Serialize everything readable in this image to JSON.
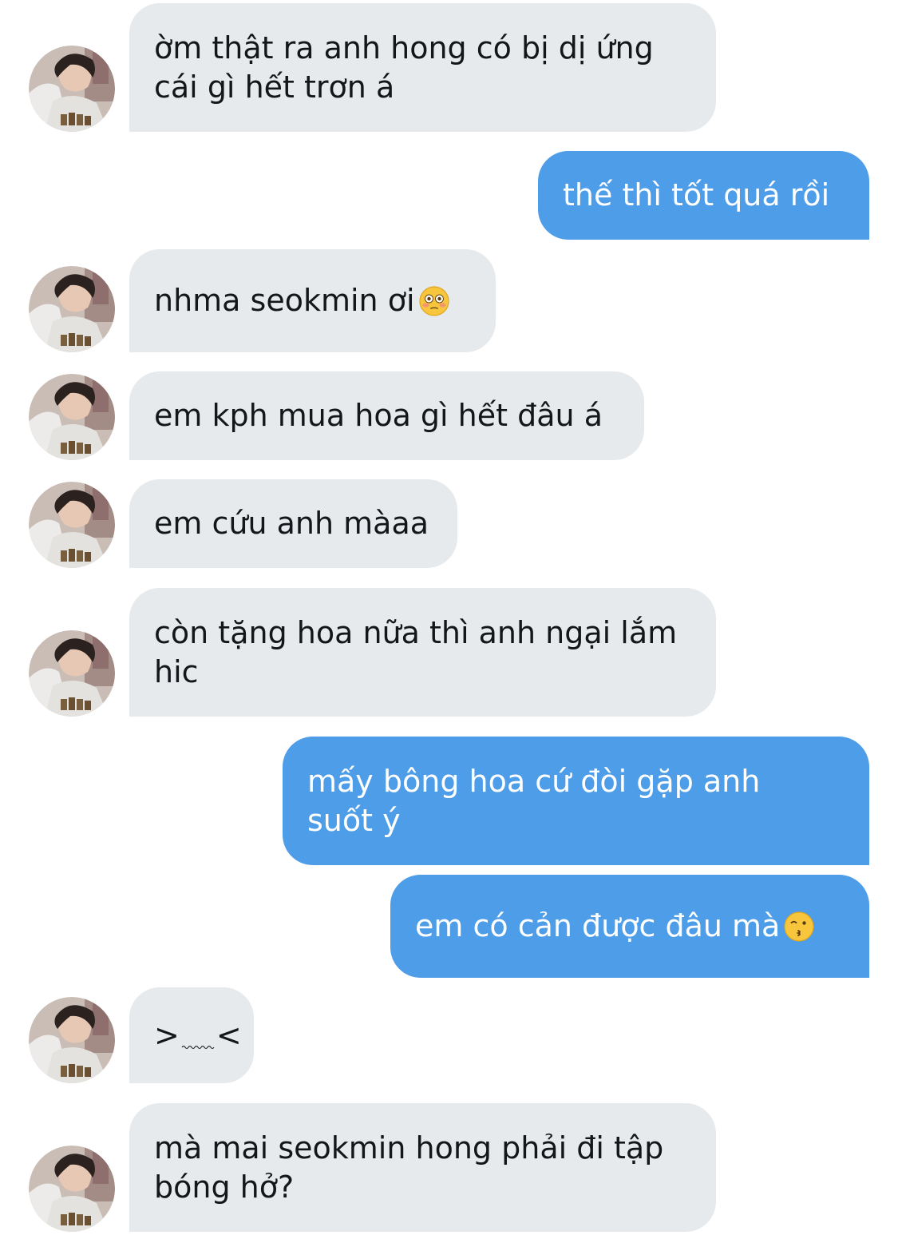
{
  "conversation": {
    "messages": [
      {
        "sender": "them",
        "lines": [
          "ờm thật ra anh hong có bị dị ứng",
          "cái gì hết trơn á"
        ]
      },
      {
        "sender": "me",
        "lines": [
          "thế thì tốt quá rồi"
        ]
      },
      {
        "sender": "them",
        "lines": [
          "nhma seokmin ơi"
        ],
        "emoji": "flushed-face-emoji"
      },
      {
        "sender": "them",
        "lines": [
          "em kph mua hoa gì hết đâu á"
        ]
      },
      {
        "sender": "them",
        "lines": [
          "em cứu anh màaa"
        ]
      },
      {
        "sender": "them",
        "lines": [
          "còn tặng hoa nữa thì anh ngại lắm",
          "hic"
        ]
      },
      {
        "sender": "me",
        "lines": [
          "mấy bông hoa cứ đòi gặp anh",
          "suốt ý"
        ]
      },
      {
        "sender": "me",
        "lines": [
          "em có cản được đâu mà"
        ],
        "emoji": "kissing-face-emoji"
      },
      {
        "sender": "them",
        "lines": [
          ">",
          "<"
        ],
        "kaomoji": true
      },
      {
        "sender": "them",
        "lines": [
          "mà mai seokmin hong phải đi tập",
          "bóng hở?"
        ]
      }
    ]
  },
  "colors": {
    "incoming_bubble": "#e6eaed",
    "outgoing_bubble": "#4e9de8",
    "incoming_text": "#14171a",
    "outgoing_text": "#ffffff"
  },
  "icons": {
    "avatar": "contact-avatar-photo"
  }
}
